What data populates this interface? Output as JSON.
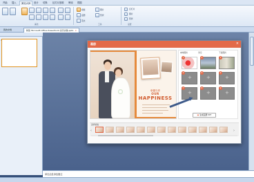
{
  "ribbon": {
    "tabs": [
      {
        "label": "开始"
      },
      {
        "label": "插入"
      },
      {
        "label": "美化大师"
      },
      {
        "label": "设计"
      },
      {
        "label": "切换"
      },
      {
        "label": "幻灯片放映"
      },
      {
        "label": "审阅"
      },
      {
        "label": "视图"
      }
    ],
    "active_tab_index": 2,
    "groups": [
      {
        "label": "美化"
      },
      {
        "label": "工具"
      },
      {
        "label": "设置"
      }
    ],
    "buttons": [
      {
        "label": "模板"
      },
      {
        "label": "画册"
      },
      {
        "label": "范文"
      },
      {
        "label": "图片"
      },
      {
        "label": "形状"
      }
    ],
    "checkboxes": [
      {
        "label": "幻灯片"
      },
      {
        "label": "图片"
      },
      {
        "label": "形状"
      }
    ]
  },
  "doc_tabs": [
    {
      "label": "我的文档"
    },
    {
      "label": "新建 Microsoft Office PowerPoint 演示文稿.pptx"
    }
  ],
  "slide_panel": {
    "thumb_number": "1"
  },
  "notes": {
    "placeholder": "单击此处添加备注"
  },
  "dialog": {
    "title": "画册",
    "close_glyph": "×",
    "preview": {
      "subtitle": "幸福与你",
      "line1": "OUR",
      "word": "HAPPINESS"
    },
    "tools": {
      "tool1": "本地图片",
      "tool2": "清空",
      "tool3": "下载图片"
    },
    "slots": [
      {
        "number": "1",
        "state": "filled"
      },
      {
        "number": "2",
        "state": "filled"
      },
      {
        "number": "3",
        "state": "filled"
      },
      {
        "number": "4",
        "state": "empty"
      },
      {
        "number": "5",
        "state": "empty"
      },
      {
        "number": "6",
        "state": "empty"
      },
      {
        "number": "7",
        "state": "empty"
      },
      {
        "number": "8",
        "state": "empty"
      },
      {
        "number": "9",
        "state": "empty"
      }
    ],
    "plus_glyph": "+",
    "generate_button": "生成画册 PPT",
    "filmstrip": {
      "label": "选择模板",
      "left_arrow": "‹",
      "right_arrow": "›"
    }
  },
  "colors": {
    "accent": "#e36a49",
    "ribbon_bg": "#dbe6f4",
    "workspace": "#4a628c",
    "heading_orange": "#d0582b"
  },
  "icons": [
    "close-icon",
    "plus-icon",
    "arrow-left-icon",
    "arrow-right-icon",
    "picture-icon"
  ]
}
